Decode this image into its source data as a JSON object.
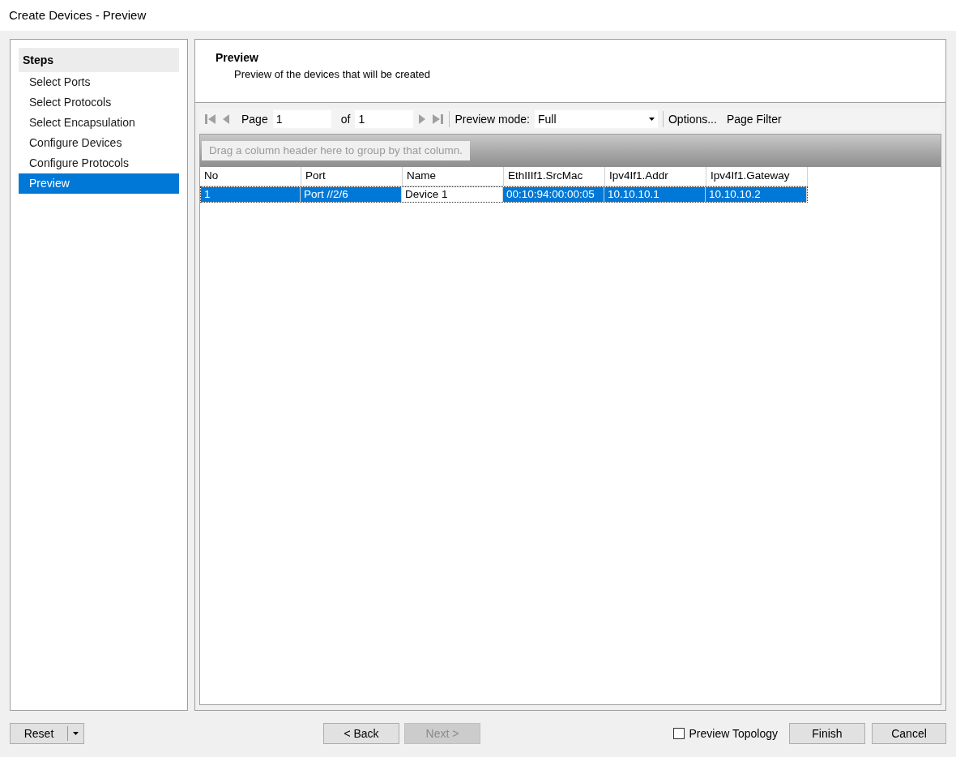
{
  "window": {
    "title": "Create Devices - Preview"
  },
  "steps": {
    "title": "Steps",
    "items": [
      {
        "label": "Select Ports",
        "selected": false
      },
      {
        "label": "Select Protocols",
        "selected": false
      },
      {
        "label": "Select Encapsulation",
        "selected": false
      },
      {
        "label": "Configure Devices",
        "selected": false
      },
      {
        "label": "Configure Protocols",
        "selected": false
      },
      {
        "label": "Preview",
        "selected": true
      }
    ]
  },
  "header": {
    "title": "Preview",
    "subtitle": "Preview of the devices that will be created"
  },
  "pager": {
    "page_label": "Page",
    "page": "1",
    "of_label": "of",
    "total": "1",
    "mode_label": "Preview mode:",
    "mode": "Full",
    "options": "Options...",
    "filter": "Page Filter"
  },
  "group_hint": "Drag a column header here to group by that column.",
  "table": {
    "columns": [
      "No",
      "Port",
      "Name",
      "EthIIIf1.SrcMac",
      "Ipv4If1.Addr",
      "Ipv4If1.Gateway"
    ],
    "rows": [
      {
        "selected": true,
        "cells": [
          {
            "text": "1",
            "focused": false
          },
          {
            "text": "Port //2/6",
            "focused": false
          },
          {
            "text": "Device 1",
            "focused": true
          },
          {
            "text": "00:10:94:00:00:05",
            "focused": false
          },
          {
            "text": "10.10.10.1",
            "focused": false
          },
          {
            "text": "10.10.10.2",
            "focused": false
          }
        ]
      }
    ]
  },
  "footer": {
    "reset": "Reset",
    "back": {
      "label": "< Back",
      "disabled": false
    },
    "next": {
      "label": "Next >",
      "disabled": true
    },
    "preview_topology": {
      "label": "Preview Topology",
      "checked": false
    },
    "finish": "Finish",
    "cancel": "Cancel"
  }
}
